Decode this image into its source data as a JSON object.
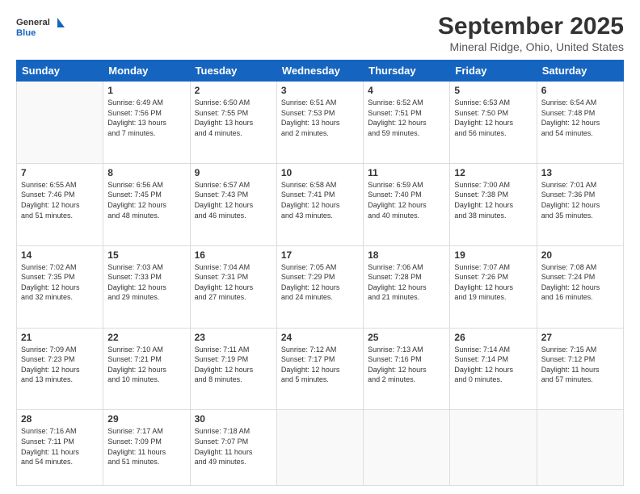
{
  "logo": {
    "line1": "General",
    "line2": "Blue"
  },
  "title": "September 2025",
  "subtitle": "Mineral Ridge, Ohio, United States",
  "days_of_week": [
    "Sunday",
    "Monday",
    "Tuesday",
    "Wednesday",
    "Thursday",
    "Friday",
    "Saturday"
  ],
  "weeks": [
    [
      {
        "day": "",
        "info": ""
      },
      {
        "day": "1",
        "info": "Sunrise: 6:49 AM\nSunset: 7:56 PM\nDaylight: 13 hours\nand 7 minutes."
      },
      {
        "day": "2",
        "info": "Sunrise: 6:50 AM\nSunset: 7:55 PM\nDaylight: 13 hours\nand 4 minutes."
      },
      {
        "day": "3",
        "info": "Sunrise: 6:51 AM\nSunset: 7:53 PM\nDaylight: 13 hours\nand 2 minutes."
      },
      {
        "day": "4",
        "info": "Sunrise: 6:52 AM\nSunset: 7:51 PM\nDaylight: 12 hours\nand 59 minutes."
      },
      {
        "day": "5",
        "info": "Sunrise: 6:53 AM\nSunset: 7:50 PM\nDaylight: 12 hours\nand 56 minutes."
      },
      {
        "day": "6",
        "info": "Sunrise: 6:54 AM\nSunset: 7:48 PM\nDaylight: 12 hours\nand 54 minutes."
      }
    ],
    [
      {
        "day": "7",
        "info": "Sunrise: 6:55 AM\nSunset: 7:46 PM\nDaylight: 12 hours\nand 51 minutes."
      },
      {
        "day": "8",
        "info": "Sunrise: 6:56 AM\nSunset: 7:45 PM\nDaylight: 12 hours\nand 48 minutes."
      },
      {
        "day": "9",
        "info": "Sunrise: 6:57 AM\nSunset: 7:43 PM\nDaylight: 12 hours\nand 46 minutes."
      },
      {
        "day": "10",
        "info": "Sunrise: 6:58 AM\nSunset: 7:41 PM\nDaylight: 12 hours\nand 43 minutes."
      },
      {
        "day": "11",
        "info": "Sunrise: 6:59 AM\nSunset: 7:40 PM\nDaylight: 12 hours\nand 40 minutes."
      },
      {
        "day": "12",
        "info": "Sunrise: 7:00 AM\nSunset: 7:38 PM\nDaylight: 12 hours\nand 38 minutes."
      },
      {
        "day": "13",
        "info": "Sunrise: 7:01 AM\nSunset: 7:36 PM\nDaylight: 12 hours\nand 35 minutes."
      }
    ],
    [
      {
        "day": "14",
        "info": "Sunrise: 7:02 AM\nSunset: 7:35 PM\nDaylight: 12 hours\nand 32 minutes."
      },
      {
        "day": "15",
        "info": "Sunrise: 7:03 AM\nSunset: 7:33 PM\nDaylight: 12 hours\nand 29 minutes."
      },
      {
        "day": "16",
        "info": "Sunrise: 7:04 AM\nSunset: 7:31 PM\nDaylight: 12 hours\nand 27 minutes."
      },
      {
        "day": "17",
        "info": "Sunrise: 7:05 AM\nSunset: 7:29 PM\nDaylight: 12 hours\nand 24 minutes."
      },
      {
        "day": "18",
        "info": "Sunrise: 7:06 AM\nSunset: 7:28 PM\nDaylight: 12 hours\nand 21 minutes."
      },
      {
        "day": "19",
        "info": "Sunrise: 7:07 AM\nSunset: 7:26 PM\nDaylight: 12 hours\nand 19 minutes."
      },
      {
        "day": "20",
        "info": "Sunrise: 7:08 AM\nSunset: 7:24 PM\nDaylight: 12 hours\nand 16 minutes."
      }
    ],
    [
      {
        "day": "21",
        "info": "Sunrise: 7:09 AM\nSunset: 7:23 PM\nDaylight: 12 hours\nand 13 minutes."
      },
      {
        "day": "22",
        "info": "Sunrise: 7:10 AM\nSunset: 7:21 PM\nDaylight: 12 hours\nand 10 minutes."
      },
      {
        "day": "23",
        "info": "Sunrise: 7:11 AM\nSunset: 7:19 PM\nDaylight: 12 hours\nand 8 minutes."
      },
      {
        "day": "24",
        "info": "Sunrise: 7:12 AM\nSunset: 7:17 PM\nDaylight: 12 hours\nand 5 minutes."
      },
      {
        "day": "25",
        "info": "Sunrise: 7:13 AM\nSunset: 7:16 PM\nDaylight: 12 hours\nand 2 minutes."
      },
      {
        "day": "26",
        "info": "Sunrise: 7:14 AM\nSunset: 7:14 PM\nDaylight: 12 hours\nand 0 minutes."
      },
      {
        "day": "27",
        "info": "Sunrise: 7:15 AM\nSunset: 7:12 PM\nDaylight: 11 hours\nand 57 minutes."
      }
    ],
    [
      {
        "day": "28",
        "info": "Sunrise: 7:16 AM\nSunset: 7:11 PM\nDaylight: 11 hours\nand 54 minutes."
      },
      {
        "day": "29",
        "info": "Sunrise: 7:17 AM\nSunset: 7:09 PM\nDaylight: 11 hours\nand 51 minutes."
      },
      {
        "day": "30",
        "info": "Sunrise: 7:18 AM\nSunset: 7:07 PM\nDaylight: 11 hours\nand 49 minutes."
      },
      {
        "day": "",
        "info": ""
      },
      {
        "day": "",
        "info": ""
      },
      {
        "day": "",
        "info": ""
      },
      {
        "day": "",
        "info": ""
      }
    ]
  ]
}
